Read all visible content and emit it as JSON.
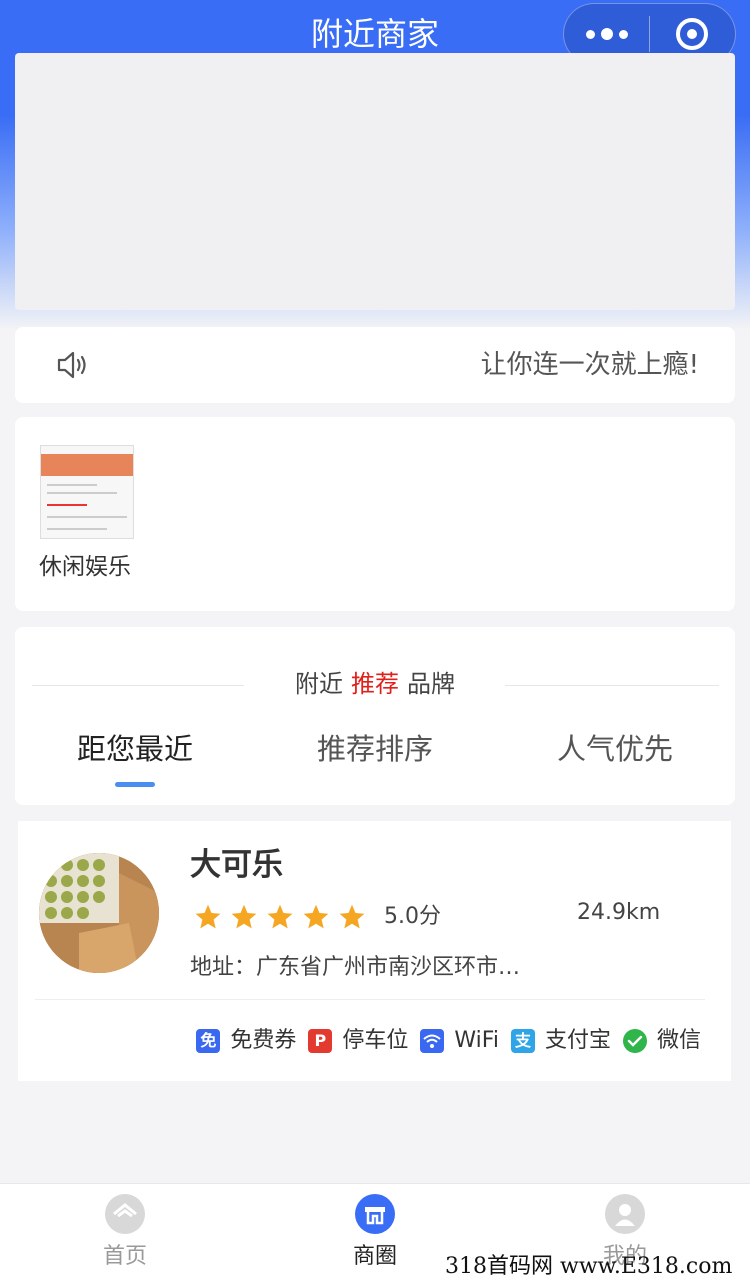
{
  "header": {
    "title": "附近商家"
  },
  "notice": {
    "text": "让你连一次就上瘾!"
  },
  "categories": [
    {
      "label": "休闲娱乐"
    }
  ],
  "section": {
    "title_left": "附近",
    "title_highlight": "推荐",
    "title_right": "品牌",
    "tabs": [
      {
        "label": "距您最近"
      },
      {
        "label": "推荐排序"
      },
      {
        "label": "人气优先"
      }
    ]
  },
  "shop": {
    "name": "大可乐",
    "rating": 5,
    "score_text": "5.0分",
    "distance": "24.9km",
    "address": "地址：广东省广州市南沙区环市…",
    "features": [
      {
        "icon": "coupon-icon",
        "badge": "免",
        "label": "免费券",
        "color": "#3b68f0"
      },
      {
        "icon": "parking-icon",
        "badge": "P",
        "label": "停车位",
        "color": "#e33a30"
      },
      {
        "icon": "wifi-icon",
        "badge": "",
        "label": "WiFi",
        "color": "#3b68f0"
      },
      {
        "icon": "alipay-icon",
        "badge": "支",
        "label": "支付宝",
        "color": "#2fa5e8"
      },
      {
        "icon": "wechat-icon",
        "badge": "",
        "label": "微信",
        "color": "#2fb54a"
      }
    ]
  },
  "tabbar": [
    {
      "label": "首页",
      "icon": "home-icon"
    },
    {
      "label": "商圈",
      "icon": "shop-district-icon"
    },
    {
      "label": "我的",
      "icon": "profile-icon"
    }
  ],
  "watermark": "318首码网 www.E318.com",
  "colors": {
    "primary": "#3a6df5",
    "highlight": "#e0201b",
    "star": "#f5a623",
    "tab_indicator": "#4a8ef0"
  }
}
